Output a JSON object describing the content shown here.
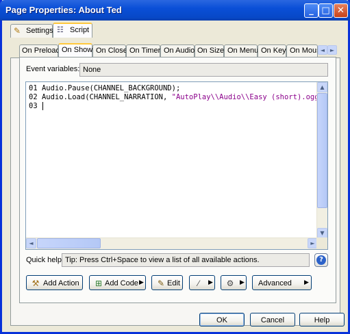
{
  "window": {
    "title": "Page Properties: About Ted"
  },
  "title_buttons": {
    "minimize": "_",
    "maximize": "□",
    "close": "✕"
  },
  "top_tabs": [
    {
      "label": "Settings",
      "icon": "pencil-icon"
    },
    {
      "label": "Script",
      "icon": "script-icon"
    }
  ],
  "event_tabs": [
    {
      "label": "On Preload"
    },
    {
      "label": "On Show"
    },
    {
      "label": "On Close"
    },
    {
      "label": "On Timer"
    },
    {
      "label": "On Audio"
    },
    {
      "label": "On Size"
    },
    {
      "label": "On Menu"
    },
    {
      "label": "On Key"
    },
    {
      "label": "On Mous"
    }
  ],
  "tab_scroll": {
    "left": "◄",
    "right": "►"
  },
  "event_variables": {
    "label": "Event variables:",
    "value": "None"
  },
  "code": {
    "lines": [
      {
        "num": "01",
        "text": "Audio.Pause(CHANNEL_BACKGROUND);",
        "string_part": ""
      },
      {
        "num": "02",
        "text": "Audio.Load(CHANNEL_NARRATION,",
        "string_part": " \"AutoPlay\\\\Audio\\\\Easy (short).ogg\""
      },
      {
        "num": "03",
        "text": "",
        "string_part": ""
      }
    ]
  },
  "scroll_arrows": {
    "up": "▲",
    "down": "▼",
    "left": "◄",
    "right": "►"
  },
  "quick_help": {
    "label": "Quick help:",
    "text": "Tip: Press Ctrl+Space to view a list of all available actions."
  },
  "help_icon_glyph": "?",
  "toolbar": {
    "add_action": "Add Action",
    "add_code": "Add Code",
    "edit": "Edit",
    "advanced": "Advanced",
    "menu_arrow": "▶"
  },
  "dialog_buttons": {
    "ok": "OK",
    "cancel": "Cancel",
    "help": "Help"
  },
  "colors": {
    "titlebar": "#0a4fd7",
    "active_tab_accent": "#ffc83c",
    "string_literal": "#8b008b"
  }
}
